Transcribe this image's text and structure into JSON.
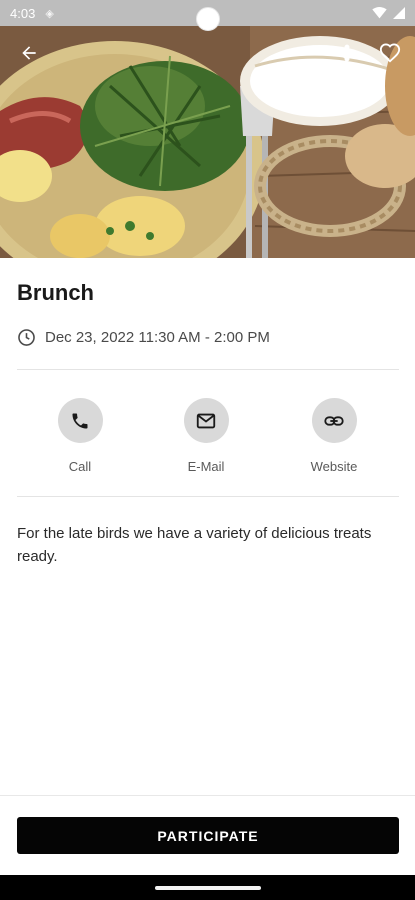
{
  "status_bar": {
    "time": "4:03",
    "icons": [
      "data-saver-icon",
      "wifi-icon",
      "signal-icon"
    ]
  },
  "hero": {
    "image_desc": "photo of brunch plate with eggs, bacon, arugula and bread",
    "icons": [
      "back-arrow-icon",
      "share-icon",
      "heart-icon"
    ]
  },
  "event": {
    "title": "Brunch",
    "datetime": "Dec 23, 2022 11:30 AM - 2:00 PM",
    "description": "For the late birds we have a variety of delicious treats ready."
  },
  "actions": {
    "call_label": "Call",
    "email_label": "E-Mail",
    "website_label": "Website"
  },
  "footer": {
    "participate_label": "PARTICIPATE"
  },
  "colors": {
    "primary_button": "#050505",
    "action_circle": "#d9d9d9",
    "status_bar": "#bdbdbd"
  }
}
